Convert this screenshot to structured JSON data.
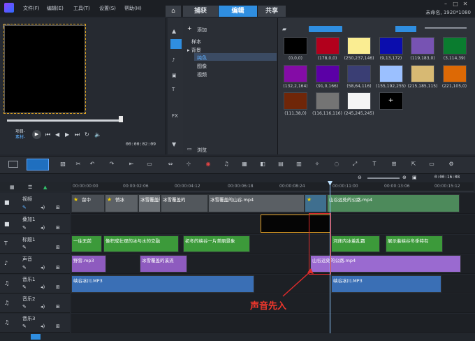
{
  "menu": [
    "文件(F)",
    "编辑(E)",
    "工具(T)",
    "设置(S)",
    "帮助(H)"
  ],
  "mode_tabs": {
    "capture": "捕获",
    "edit": "编辑",
    "share": "共享"
  },
  "project_info": "未命名, 1920*1080",
  "preview": {
    "label_project": "项目-",
    "label_clip": "素材-",
    "timecode": "00:00:02:09",
    "corner_label": "影片#1"
  },
  "library": {
    "add_label": "添加",
    "tree": [
      "样本",
      "背景",
      "纯色",
      "图像",
      "视频"
    ],
    "browse_label": "浏览",
    "colors": [
      {
        "hex": "#000000",
        "label": "(0,0,0)"
      },
      {
        "hex": "#b2001c",
        "label": "(178,0,0)"
      },
      {
        "hex": "#faed92",
        "label": "(250,237,146)"
      },
      {
        "hex": "#0b0dad",
        "label": "(9,13,172)"
      },
      {
        "hex": "#7753b3",
        "label": "(119,183,0)"
      },
      {
        "hex": "#0a7c2f",
        "label": "(3,114,39)"
      },
      {
        "hex": "#840ca6",
        "label": "(132,2,164)"
      },
      {
        "hex": "#5b00a6",
        "label": "(91,0,166)"
      },
      {
        "hex": "#3a3e74",
        "label": "(58,64,116)"
      },
      {
        "hex": "#9bc0ff",
        "label": "(155,192,255)"
      },
      {
        "hex": "#d7b973",
        "label": "(215,185,115)"
      },
      {
        "hex": "#dd6905",
        "label": "(221,105,0)"
      },
      {
        "hex": "#6f2608",
        "label": "(111,38,0)"
      },
      {
        "hex": "#747474",
        "label": "(116,116,116)"
      },
      {
        "hex": "#f5f5f5",
        "label": "(245,245,245)"
      },
      {
        "hex": "#000000",
        "label": "+"
      }
    ]
  },
  "timeline": {
    "ticks": [
      "00:00:00:00",
      "00:00:02:06",
      "00:00:04:12",
      "00:00:06:18",
      "00:00:08:24",
      "00:00:11:00",
      "00:00:13:06",
      "00:00:15:12"
    ],
    "zoom_time": "0:00:16:08",
    "tracks": {
      "video": "视频",
      "overlay": "叠加1",
      "title": "标题1",
      "voice": "声音",
      "music1": "音乐1",
      "music2": "音乐2",
      "music3": "音乐3"
    },
    "video_clips": [
      "留中",
      "悄冰",
      "冰雪覆盖的",
      "冰雪覆盖的山谷.mp4",
      "",
      "山谷远处的公路.mp4"
    ],
    "title_clips": [
      "一往无前",
      "像积成壮观的冰与水的交融",
      "初冬的峡谷一片美丽景象",
      "河床内冰着乱霜",
      "展示着峡谷冬季特有"
    ],
    "voice_clips": [
      "野营.mp3",
      "冰雪覆盖的溪流",
      "山谷远处的公路.mp4"
    ],
    "music_clips": [
      "峡谷冰川.MP3",
      "峡谷冰川.MP3"
    ],
    "annotation": "声音先入"
  }
}
